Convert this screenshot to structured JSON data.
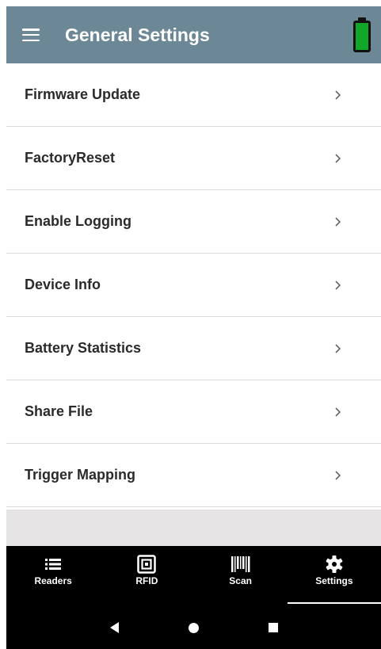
{
  "header": {
    "title": "General Settings",
    "menu_icon": "hamburger-menu-icon",
    "battery_icon": "battery-full-icon",
    "battery_color": "#11a82a"
  },
  "settings_items": [
    {
      "label": "Firmware Update"
    },
    {
      "label": "FactoryReset"
    },
    {
      "label": "Enable Logging"
    },
    {
      "label": "Device Info"
    },
    {
      "label": "Battery Statistics"
    },
    {
      "label": "Share File"
    },
    {
      "label": "Trigger Mapping"
    }
  ],
  "tabs": [
    {
      "label": "Readers",
      "icon": "list-icon"
    },
    {
      "label": "RFID",
      "icon": "rfid-tag-icon"
    },
    {
      "label": "Scan",
      "icon": "barcode-icon"
    },
    {
      "label": "Settings",
      "icon": "gear-icon",
      "active": true
    }
  ],
  "system_nav": {
    "back_icon": "back-triangle-icon",
    "home_icon": "home-circle-icon",
    "recents_icon": "recents-square-icon"
  },
  "colors": {
    "appbar": "#6c8796",
    "divider": "#dcdcdc",
    "bottom_bar": "#000000",
    "spacer": "#e6e4e4"
  }
}
